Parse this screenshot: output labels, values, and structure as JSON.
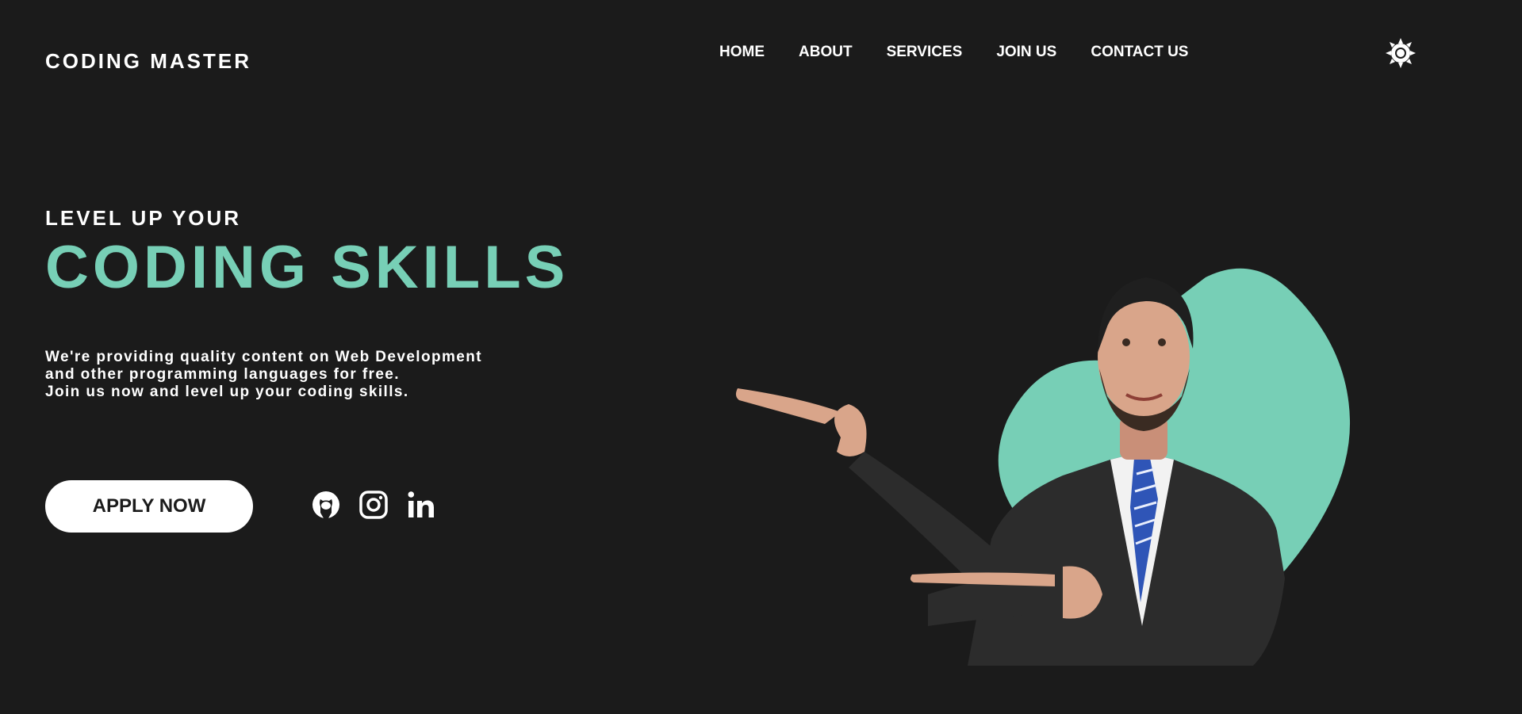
{
  "brand": {
    "name": "CODING MASTER"
  },
  "nav": {
    "items": [
      {
        "label": "HOME"
      },
      {
        "label": "ABOUT"
      },
      {
        "label": "SERVICES"
      },
      {
        "label": "JOIN US"
      },
      {
        "label": "CONTACT US"
      }
    ]
  },
  "theme_toggle": {
    "icon": "sun-icon"
  },
  "hero": {
    "kicker": "LEVEL UP YOUR",
    "headline": "CODING SKILLS",
    "description_lines": [
      "We're providing quality content on Web Development",
      "and other programming languages for free.",
      "Join us now and level up your coding skills."
    ],
    "cta_label": "APPLY NOW"
  },
  "socials": [
    {
      "icon": "github-icon"
    },
    {
      "icon": "instagram-icon"
    },
    {
      "icon": "linkedin-icon"
    }
  ],
  "colors": {
    "background": "#1b1b1b",
    "accent": "#77cfb6",
    "text": "#ffffff",
    "button_bg": "#ffffff",
    "button_text": "#1b1b1b"
  }
}
